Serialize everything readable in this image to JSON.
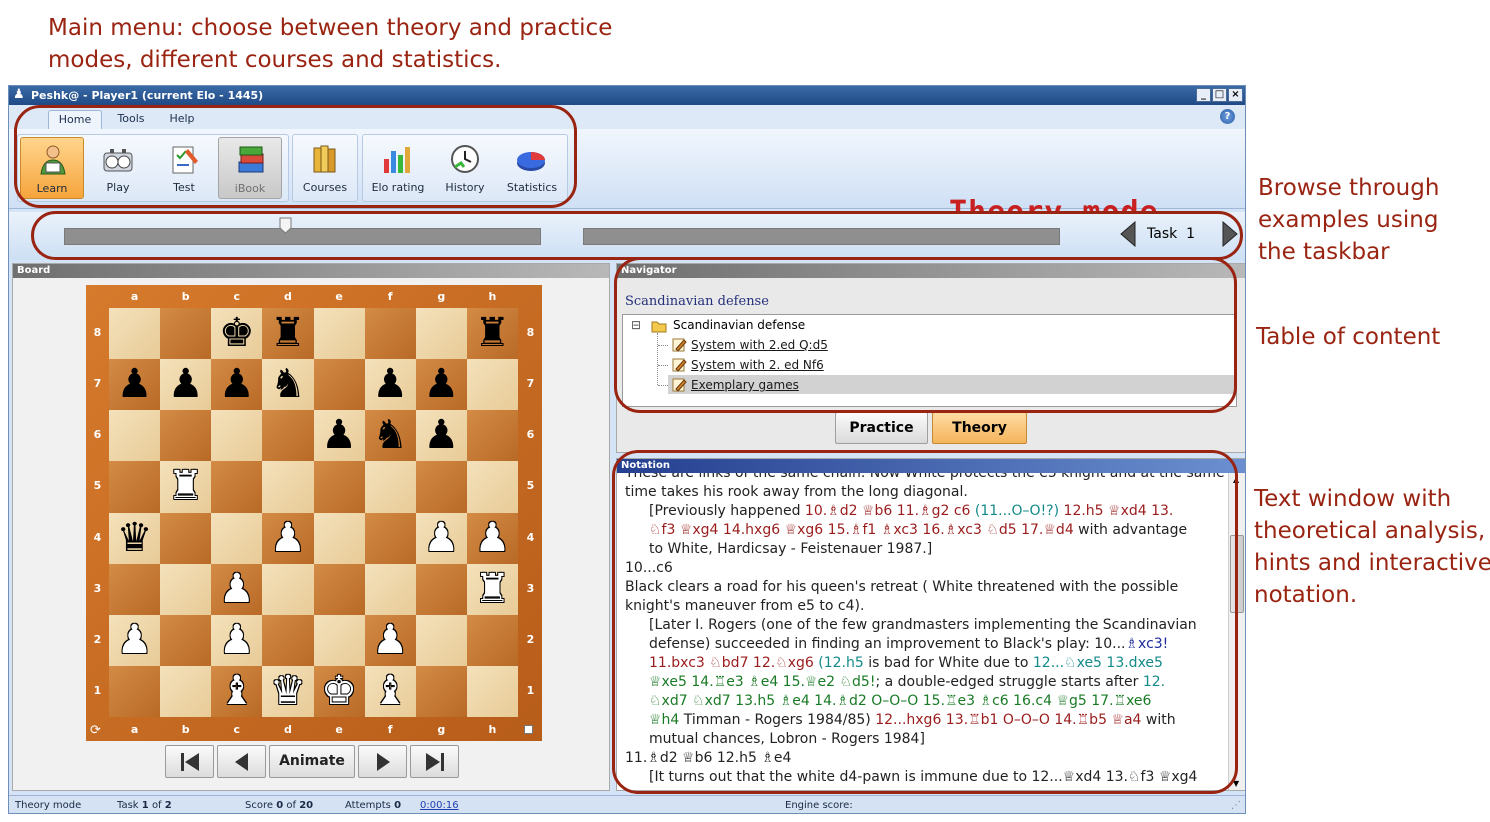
{
  "annotations": {
    "main_menu": "Main menu: choose between theory and practice\nmodes, different courses and statistics.",
    "taskbar": "Browse through\nexamples using\nthe taskbar",
    "toc": "Table of content",
    "text_window": "Text window with\ntheoretical analysis,\nhints and interactive\nnotation."
  },
  "window": {
    "title": "Peshk@ - Player1 (current Elo - 1445)",
    "controls": [
      "_",
      "□",
      "×"
    ]
  },
  "ribbon": {
    "tabs": [
      "Home",
      "Tools",
      "Help"
    ],
    "active_tab": "Home",
    "help_icon": "?",
    "buttons": {
      "learn": "Learn",
      "play": "Play",
      "test": "Test",
      "ibook": "iBook",
      "courses": "Courses",
      "elo": "Elo rating",
      "history": "History",
      "statistics": "Statistics"
    },
    "mode_label": "Theory mode"
  },
  "taskbar": {
    "label": "Task  1"
  },
  "board": {
    "title": "Board",
    "files": [
      "a",
      "b",
      "c",
      "d",
      "e",
      "f",
      "g",
      "h"
    ],
    "ranks": [
      "8",
      "7",
      "6",
      "5",
      "4",
      "3",
      "2",
      "1"
    ],
    "pieces": [
      {
        "sq": "c8",
        "glyph": "♚",
        "color": "b"
      },
      {
        "sq": "d8",
        "glyph": "♜",
        "color": "b"
      },
      {
        "sq": "h8",
        "glyph": "♜",
        "color": "b"
      },
      {
        "sq": "a7",
        "glyph": "♟",
        "color": "b"
      },
      {
        "sq": "b7",
        "glyph": "♟",
        "color": "b"
      },
      {
        "sq": "c7",
        "glyph": "♟",
        "color": "b"
      },
      {
        "sq": "d7",
        "glyph": "♞",
        "color": "b"
      },
      {
        "sq": "f7",
        "glyph": "♟",
        "color": "b"
      },
      {
        "sq": "g7",
        "glyph": "♟",
        "color": "b"
      },
      {
        "sq": "e6",
        "glyph": "♟",
        "color": "b"
      },
      {
        "sq": "f6",
        "glyph": "♞",
        "color": "b"
      },
      {
        "sq": "g6",
        "glyph": "♟",
        "color": "b"
      },
      {
        "sq": "b5",
        "glyph": "♜",
        "color": "w"
      },
      {
        "sq": "a4",
        "glyph": "♛",
        "color": "b"
      },
      {
        "sq": "d4",
        "glyph": "♟",
        "color": "w"
      },
      {
        "sq": "g4",
        "glyph": "♟",
        "color": "w"
      },
      {
        "sq": "h4",
        "glyph": "♟",
        "color": "w"
      },
      {
        "sq": "c3",
        "glyph": "♟",
        "color": "w"
      },
      {
        "sq": "h3",
        "glyph": "♜",
        "color": "w"
      },
      {
        "sq": "a2",
        "glyph": "♟",
        "color": "w"
      },
      {
        "sq": "c2",
        "glyph": "♟",
        "color": "w"
      },
      {
        "sq": "f2",
        "glyph": "♟",
        "color": "w"
      },
      {
        "sq": "c1",
        "glyph": "♝",
        "color": "w"
      },
      {
        "sq": "d1",
        "glyph": "♛",
        "color": "w"
      },
      {
        "sq": "e1",
        "glyph": "♚",
        "color": "w"
      },
      {
        "sq": "f1",
        "glyph": "♝",
        "color": "w"
      }
    ],
    "flip_icon": "⟳",
    "animate_label": "Animate"
  },
  "navigator": {
    "title": "Navigator",
    "heading": "Scandinavian defense",
    "tree": {
      "root": "Scandinavian defense",
      "expander": "⊟",
      "items": [
        "System with 2.ed Q:d5",
        "System with 2. ed Nf6",
        "Exemplary games"
      ],
      "selected_index": 2
    },
    "practice_label": "Practice",
    "theory_label": "Theory"
  },
  "notation": {
    "title": "Notation",
    "lines": [
      {
        "indent": false,
        "parts": [
          {
            "t": "These are links of the same chain. Now White protects the e5 knight and at the same",
            "c": ""
          }
        ]
      },
      {
        "indent": false,
        "parts": [
          {
            "t": "time takes his rook away from the long diagonal.",
            "c": ""
          }
        ]
      },
      {
        "indent": true,
        "parts": [
          {
            "t": "[Previously happened ",
            "c": ""
          },
          {
            "t": "10.♗d2 ♕b6 11.♗g2 c6",
            "c": "red"
          },
          {
            "t": " (11...O–O!?) ",
            "c": "teal"
          },
          {
            "t": "12.h5 ♕xd4 13.",
            "c": "red"
          }
        ]
      },
      {
        "indent": true,
        "parts": [
          {
            "t": "♘f3 ♕xg4 14.hxg6 ♕xg6 15.♗f1 ♗xc3 16.♗xc3 ♘d5 17.♕d4",
            "c": "red"
          },
          {
            "t": " with advantage",
            "c": ""
          }
        ]
      },
      {
        "indent": true,
        "parts": [
          {
            "t": "to White, Hardicsay - Feistenauer 1987.]",
            "c": ""
          }
        ]
      },
      {
        "indent": false,
        "parts": [
          {
            "t": "10...c6",
            "c": ""
          }
        ]
      },
      {
        "indent": false,
        "parts": [
          {
            "t": "Black clears a road for his queen's retreat ( White threatened with the possible",
            "c": ""
          }
        ]
      },
      {
        "indent": false,
        "parts": [
          {
            "t": "knight's maneuver from e5 to c4).",
            "c": ""
          }
        ]
      },
      {
        "indent": true,
        "parts": [
          {
            "t": "[Later I. Rogers (one of the few grandmasters implementing the Scandinavian",
            "c": ""
          }
        ]
      },
      {
        "indent": true,
        "parts": [
          {
            "t": "defense) succeeded in finding an improvement to Black's play: 10...",
            "c": ""
          },
          {
            "t": "♗xc3!",
            "c": "mv"
          }
        ]
      },
      {
        "indent": true,
        "parts": [
          {
            "t": "11.bxc3 ♘bd7 12.♘xg6",
            "c": "red"
          },
          {
            "t": " (12.h5",
            "c": "teal"
          },
          {
            "t": " is bad for White due to ",
            "c": ""
          },
          {
            "t": "12...♘xe5 13.dxe5",
            "c": "teal"
          }
        ]
      },
      {
        "indent": true,
        "parts": [
          {
            "t": "♕xe5 14.♖e3 ♗e4 15.♕e2 ♘d5!",
            "c": "grn"
          },
          {
            "t": "; a double-edged struggle starts after ",
            "c": ""
          },
          {
            "t": "12.",
            "c": "teal"
          }
        ]
      },
      {
        "indent": true,
        "parts": [
          {
            "t": "♘xd7 ♘xd7 13.h5 ♗e4 14.♗d2 O–O–O 15.♖e3 ♗c6 16.c4 ♕g5 17.♖xe6",
            "c": "grn"
          }
        ]
      },
      {
        "indent": true,
        "parts": [
          {
            "t": "♕h4",
            "c": "grn"
          },
          {
            "t": " Timman - Rogers 1984/85) ",
            "c": ""
          },
          {
            "t": "12...hxg6 13.♖b1 O–O–O 14.♖b5 ♕a4",
            "c": "red"
          },
          {
            "t": " with",
            "c": ""
          }
        ]
      },
      {
        "indent": true,
        "parts": [
          {
            "t": "mutual chances, Lobron - Rogers 1984]",
            "c": ""
          }
        ]
      },
      {
        "indent": false,
        "parts": [
          {
            "t": "11.♗d2 ♕b6 12.h5 ♗e4",
            "c": ""
          }
        ]
      },
      {
        "indent": true,
        "parts": [
          {
            "t": "[It turns out that the white d4-pawn is immune due to 12...♕xd4 13.♘f3 ♕xg4",
            "c": ""
          }
        ]
      }
    ]
  },
  "status": {
    "mode": "Theory mode",
    "task_prefix": "Task",
    "task_current": "1",
    "task_of": "of",
    "task_total": "2",
    "score_prefix": "Score",
    "score_value": "0",
    "score_of": "of",
    "score_total": "20",
    "attempts_prefix": "Attempts",
    "attempts_value": "0",
    "time": "0:00:16",
    "engine": "Engine score:"
  },
  "colors": {
    "annotation": "#9a2412",
    "mode_label": "#c82020",
    "active_button": "#f6a53c"
  }
}
